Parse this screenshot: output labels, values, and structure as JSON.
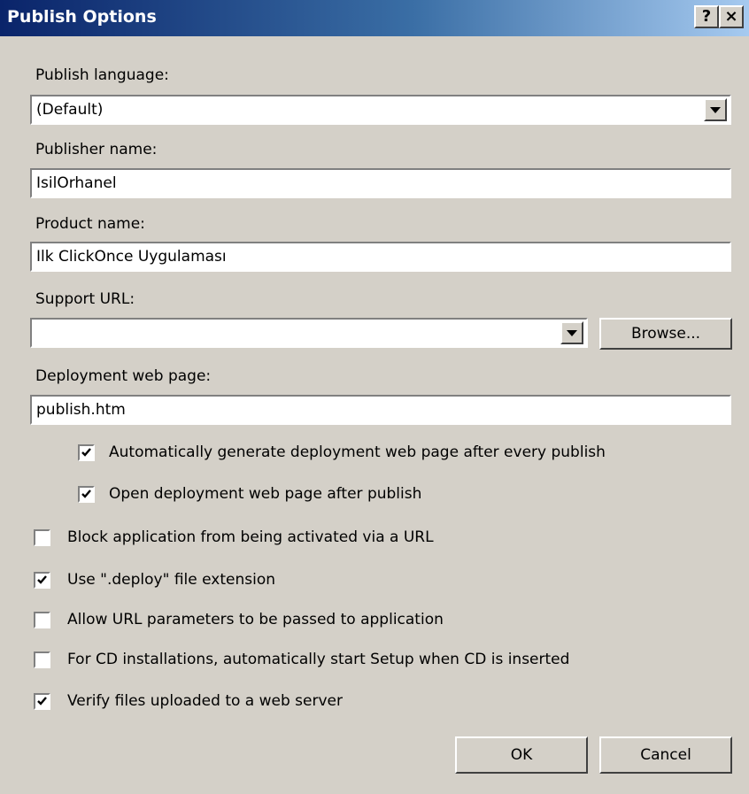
{
  "window": {
    "title": "Publish Options",
    "help_button": "?",
    "close_button": "×"
  },
  "form": {
    "publish_language_label": "Publish language:",
    "publish_language_value": "(Default)",
    "publisher_name_label": "Publisher name:",
    "publisher_name_value": "IsilOrhanel",
    "product_name_label": "Product name:",
    "product_name_value": "Ilk ClickOnce Uygulaması",
    "support_url_label": "Support URL:",
    "support_url_value": "",
    "browse_label": "Browse...",
    "deployment_page_label": "Deployment web page:",
    "deployment_page_value": "publish.htm"
  },
  "checkboxes": {
    "auto_generate": {
      "label": "Automatically generate deployment web page after every publish",
      "checked": true
    },
    "open_after": {
      "label": "Open deployment web page after publish",
      "checked": true
    },
    "block_url": {
      "label": "Block application from being activated via a URL",
      "checked": false
    },
    "use_deploy": {
      "label": "Use \".deploy\" file extension",
      "checked": true
    },
    "allow_params": {
      "label": "Allow URL parameters to be passed to application",
      "checked": false
    },
    "cd_install": {
      "label": "For CD installations, automatically start Setup when CD is inserted",
      "checked": false
    },
    "verify_files": {
      "label": "Verify files uploaded to a web server",
      "checked": true
    }
  },
  "buttons": {
    "ok": "OK",
    "cancel": "Cancel"
  }
}
